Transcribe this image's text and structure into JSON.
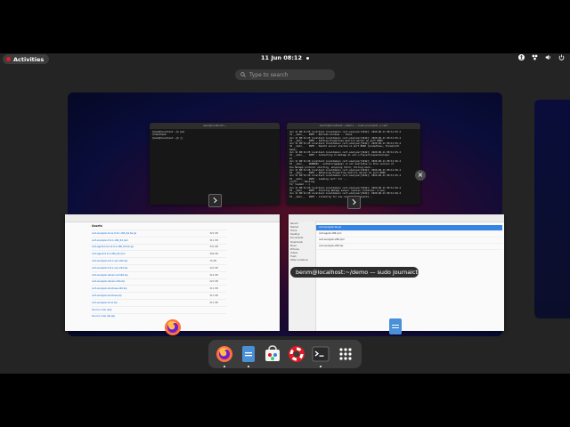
{
  "topbar": {
    "activities_label": "Activities",
    "clock": "11 Jun  08:12",
    "tray_icons": [
      "accessibility-icon",
      "network-icon",
      "volume-icon",
      "power-icon"
    ]
  },
  "search": {
    "placeholder": "Type to search"
  },
  "terminal_left": {
    "title": "user@localhost:~",
    "lines": "[benm@localhost ~]$ pwd\n/home/benm\n[benm@localhost ~]$ []"
  },
  "terminal_right": {
    "title": "benm@localhost:~/demo — sudo journalctl -u cert",
    "lines": "Jun 11 08:11:25 localhost.localdomain cert-analyzer[3442]: 2020-06-11 08:11:25.4\n31 __main__   INFO - Refresh windows -- false\nJun 11 08:11:25 localhost.localdomain cert-analyzer[3442]: 2020-06-11 08:11:25.4\n31 __main__   INFO - Setting Properties metrics server on port 8000\nJun 11 08:11:25 localhost.localdomain cert-analyzer[3442]: 2020-06-11 08:11:25.4\n32 __main__   INFO - Health server started on port 8000 (prometheus, threshold=\nbase)\nJun 11 08:11:25 localhost.localdomain cert-analyzer[3442]: 2020-06-11 08:11:25.4\n32 __main__   INFO - Connecting to Netapp at ssl:///tpcert/expected/oper\nal\nJun 11 08:11:26 localhost.localdomain cert-analyzer[3442]: 2020-06-11 08:11:26.4\n53 __main__   WARNING - authstorage@api is not available in this version of\nthe Netapp protocol starting, skipping fetch; falling back...\nJun 11 08:11:26 localhost.localdomain cert-analyzer[3442]: 2020-06-11 08:11:26.4\n52 __main__   INFO - Obtaining Properties metrics server on port 8000\nJun 11 08:11:26 localhost.localdomain cert-analyzer[3442]: 2020-06-11 08:11:25.4\n52 __main__   INFO - Loading cert: for ...\n(cert: ... Waiting\nfor loaded ...)\nJun 11 08:11:26 localhost.localdomain cert-analyzer[3442]: 2020-06-11 08:11:26.4\n53 __main__   INFO - Starting Netapp sensor replies (internal: 3 sec)\nJun 11 08:11:26 localhost.localdomain cert-analyzer[3442]: 2020-06-11 08:11:26.4\n53 __main__   INFO - Listening for new certificate events..."
  },
  "browser_window": {
    "heading": "Assets",
    "assets": [
      {
        "name": "cert-analyzer-linux-0.9.1-x86_64.tar.gz",
        "size": "321 KB"
      },
      {
        "name": "cert-analyzer-0.9.1-x86_64.rpm",
        "size": "311 KB"
      },
      {
        "name": "cert-agent-linux-0.9.1-x86_64.tar.gz",
        "size": "331 KB"
      },
      {
        "name": "cert-agent-0.9.1-x86_64.rpm",
        "size": "300 KB"
      },
      {
        "name": "cert-analyzer-0.9.1-win-x64.zip",
        "size": "15 KB"
      },
      {
        "name": "cert-analyzer-0.9.1-osx-x64.zip",
        "size": "221 KB"
      },
      {
        "name": "cert-analyzer-darwin-arm64.zip",
        "size": "314 KB"
      },
      {
        "name": "cert-analyzer-darwin-x64.zip",
        "size": "221 KB"
      },
      {
        "name": "cert-analyzer-windows-x64.zip",
        "size": "311 KB"
      },
      {
        "name": "cert-analyzer-windows.zip",
        "size": "311 KB"
      },
      {
        "name": "cert-analyzer-linux.zip",
        "size": "311 KB"
      },
      {
        "name": "Source code (zip)",
        "size": ""
      },
      {
        "name": "Source code (tar.gz)",
        "size": ""
      }
    ]
  },
  "files_window": {
    "sidebar": [
      "Recent",
      "Starred",
      "Home",
      "Desktop",
      "Documents",
      "Downloads",
      "Music",
      "Pictures",
      "Videos",
      "Trash",
      "Other Locations"
    ],
    "files": [
      {
        "name": "cert-analyzer.tar.gz",
        "selected": true
      },
      {
        "name": "cert-agent-x86.rpm",
        "selected": false
      },
      {
        "name": "cert-analyzer-x86.rpm",
        "selected": false
      },
      {
        "name": "cert-analyzer-x86.zip",
        "selected": false
      }
    ]
  },
  "tooltip": {
    "text": "benm@localhost:~/demo — sudo journalctl -u c..."
  },
  "dash": {
    "apps": [
      {
        "name": "firefox-icon",
        "running": true
      },
      {
        "name": "files-icon",
        "running": true
      },
      {
        "name": "software-icon",
        "running": false
      },
      {
        "name": "help-icon",
        "running": false
      },
      {
        "name": "terminal-icon",
        "running": true
      },
      {
        "name": "show-apps-icon",
        "running": false
      }
    ]
  },
  "colors": {
    "accent": "#3584e4",
    "activities_dot": "#e01b24",
    "panel_bg": "#242424"
  }
}
